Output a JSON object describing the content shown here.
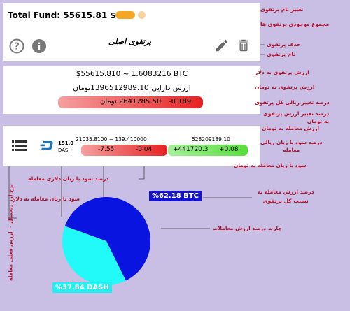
{
  "portfolio_card": {
    "total_fund_label": "Total Fund:",
    "total_fund_value": "55615.81 $",
    "portfolio_name": "پرتفوی اصلی",
    "icons": [
      "help-circle-icon",
      "info-icon",
      "edit-pencil-icon",
      "trash-icon"
    ]
  },
  "summary_card": {
    "usd_line": "$55615.810 ~ 1.6083216 BTC",
    "toman_line": "ارزش دارایی:1396512989.10تومان",
    "pill_toman": "2641285.50 تومان",
    "pill_percent": "-0.189"
  },
  "trade_row": {
    "coin_amount": "151.0",
    "coin_symbol": "DASH",
    "price_line": "21035.8100 ~ 139.410000",
    "pill_dollar_profit": "-7.55",
    "pill_dollar_percent": "-0.04",
    "trade_value_toman": "528209189.10",
    "pill_rial_profit": "+441720.3",
    "pill_rial_percent": "+0.08"
  },
  "chart_data": {
    "type": "pie",
    "labels": [
      "%62.18 BTC",
      "%37.84 DASH"
    ],
    "values": [
      62.18,
      37.84
    ],
    "colors": [
      "#0a14e0",
      "#22fafa"
    ]
  },
  "annotations": {
    "rename": "تغییر نام پرتفوی",
    "total_assets": "مجموع موجودی پرتفوی ها",
    "delete": "حذف پرتفوی",
    "name": "نام پرتفوی",
    "dollar_value": "ارزش پرتفوی به دلار",
    "toman_value": "ارزش پرتفوی به تومان",
    "rial_change": "درصد تغییر ریالی کل پرتفوی",
    "toman_change_1": "درصد تغییر ارزش پرتفوی",
    "toman_change_2": "به تومان",
    "trade_value": "ارزش معامله به تومان",
    "rial_profit_percent_1": "درصد سود یا زیان ریالی",
    "rial_profit_percent_2": "معامله",
    "rial_profit": "سود یا زیان معامله به تومان",
    "dollar_profit_percent": "درصد سود یا زیان دلاری معامله",
    "dollar_profit": "سود یا زیان معامله به دلار",
    "trade_share_1": "درصد ارزش معامله به",
    "trade_share_2": "نسبت کل پرتفوی",
    "price_vertical": "نرخ ارز دیجیتال ~ ارزش فعلی معامله",
    "chart": "چارت درصد ارزش معاملات"
  },
  "colors": {
    "background": "#c9bfe5",
    "annotation": "#b5122e",
    "red_pill": "#f04848",
    "green_pill": "#6ee84a",
    "btc_label_bg": "#1414c8",
    "dash_label_bg": "#22f0f0",
    "toggle": "#f5a623"
  }
}
